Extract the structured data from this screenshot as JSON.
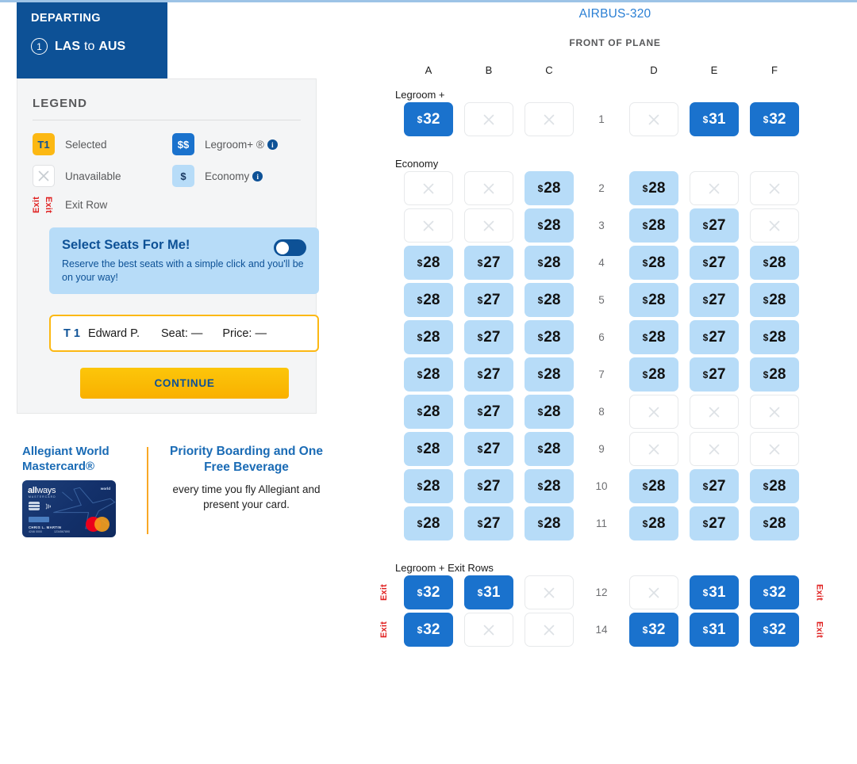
{
  "header": {
    "departing_label": "DEPARTING",
    "segment_number": "1",
    "origin": "LAS",
    "connector": "to",
    "destination": "AUS"
  },
  "legend": {
    "title": "LEGEND",
    "selected_chip": "T1",
    "selected_label": "Selected",
    "unavailable_label": "Unavailable",
    "exit_row_label": "Exit Row",
    "exit_word": "Exit",
    "legroom_chip": "$$",
    "legroom_label": "Legroom+ ®",
    "economy_chip": "$",
    "economy_label": "Economy",
    "info_glyph": "i"
  },
  "auto_select": {
    "title": "Select Seats For Me!",
    "subtitle": "Reserve the best seats with a simple click and you'll be on your way!",
    "toggle_state": "off"
  },
  "passenger": {
    "tag": "T 1",
    "name": "Edward P.",
    "seat": "Seat: —",
    "price": "Price: —"
  },
  "continue_label": "CONTINUE",
  "promo": {
    "card_title": "Allegiant World Mastercard®",
    "headline": "Priority Boarding and One Free Beverage",
    "body": "every time you fly Allegiant and present your card.",
    "card_brand_bold": "all",
    "card_brand_light": "ways",
    "card_brand_sub": "MASTERCARD",
    "card_world": "world",
    "card_holder": "CHRIS L. MARTIN",
    "card_num": "4246 0000",
    "card_num2": "1234567890"
  },
  "seatmap": {
    "plane": "AIRBUS-320",
    "front_label": "FRONT OF PLANE",
    "columns": [
      "A",
      "B",
      "C",
      "D",
      "E",
      "F"
    ],
    "section_legroom": "Legroom +",
    "section_economy": "Economy",
    "section_exit": "Legroom + Exit Rows",
    "currency": "$",
    "rows": [
      {
        "num": "1",
        "exit": false,
        "seats": [
          {
            "type": "legroom",
            "price": "32"
          },
          {
            "type": "unavailable"
          },
          {
            "type": "unavailable"
          },
          {
            "type": "unavailable"
          },
          {
            "type": "legroom",
            "price": "31"
          },
          {
            "type": "legroom",
            "price": "32"
          }
        ]
      },
      {
        "num": "2",
        "exit": false,
        "seats": [
          {
            "type": "unavailable"
          },
          {
            "type": "unavailable"
          },
          {
            "type": "economy",
            "price": "28"
          },
          {
            "type": "economy",
            "price": "28"
          },
          {
            "type": "unavailable"
          },
          {
            "type": "unavailable"
          }
        ]
      },
      {
        "num": "3",
        "exit": false,
        "seats": [
          {
            "type": "unavailable"
          },
          {
            "type": "unavailable"
          },
          {
            "type": "economy",
            "price": "28"
          },
          {
            "type": "economy",
            "price": "28"
          },
          {
            "type": "economy",
            "price": "27"
          },
          {
            "type": "unavailable"
          }
        ]
      },
      {
        "num": "4",
        "exit": false,
        "seats": [
          {
            "type": "economy",
            "price": "28"
          },
          {
            "type": "economy",
            "price": "27"
          },
          {
            "type": "economy",
            "price": "28"
          },
          {
            "type": "economy",
            "price": "28"
          },
          {
            "type": "economy",
            "price": "27"
          },
          {
            "type": "economy",
            "price": "28"
          }
        ]
      },
      {
        "num": "5",
        "exit": false,
        "seats": [
          {
            "type": "economy",
            "price": "28"
          },
          {
            "type": "economy",
            "price": "27"
          },
          {
            "type": "economy",
            "price": "28"
          },
          {
            "type": "economy",
            "price": "28"
          },
          {
            "type": "economy",
            "price": "27"
          },
          {
            "type": "economy",
            "price": "28"
          }
        ]
      },
      {
        "num": "6",
        "exit": false,
        "seats": [
          {
            "type": "economy",
            "price": "28"
          },
          {
            "type": "economy",
            "price": "27"
          },
          {
            "type": "economy",
            "price": "28"
          },
          {
            "type": "economy",
            "price": "28"
          },
          {
            "type": "economy",
            "price": "27"
          },
          {
            "type": "economy",
            "price": "28"
          }
        ]
      },
      {
        "num": "7",
        "exit": false,
        "seats": [
          {
            "type": "economy",
            "price": "28"
          },
          {
            "type": "economy",
            "price": "27"
          },
          {
            "type": "economy",
            "price": "28"
          },
          {
            "type": "economy",
            "price": "28"
          },
          {
            "type": "economy",
            "price": "27"
          },
          {
            "type": "economy",
            "price": "28"
          }
        ]
      },
      {
        "num": "8",
        "exit": false,
        "seats": [
          {
            "type": "economy",
            "price": "28"
          },
          {
            "type": "economy",
            "price": "27"
          },
          {
            "type": "economy",
            "price": "28"
          },
          {
            "type": "unavailable"
          },
          {
            "type": "unavailable"
          },
          {
            "type": "unavailable"
          }
        ]
      },
      {
        "num": "9",
        "exit": false,
        "seats": [
          {
            "type": "economy",
            "price": "28"
          },
          {
            "type": "economy",
            "price": "27"
          },
          {
            "type": "economy",
            "price": "28"
          },
          {
            "type": "unavailable"
          },
          {
            "type": "unavailable"
          },
          {
            "type": "unavailable"
          }
        ]
      },
      {
        "num": "10",
        "exit": false,
        "seats": [
          {
            "type": "economy",
            "price": "28"
          },
          {
            "type": "economy",
            "price": "27"
          },
          {
            "type": "economy",
            "price": "28"
          },
          {
            "type": "economy",
            "price": "28"
          },
          {
            "type": "economy",
            "price": "27"
          },
          {
            "type": "economy",
            "price": "28"
          }
        ]
      },
      {
        "num": "11",
        "exit": false,
        "seats": [
          {
            "type": "economy",
            "price": "28"
          },
          {
            "type": "economy",
            "price": "27"
          },
          {
            "type": "economy",
            "price": "28"
          },
          {
            "type": "economy",
            "price": "28"
          },
          {
            "type": "economy",
            "price": "27"
          },
          {
            "type": "economy",
            "price": "28"
          }
        ]
      },
      {
        "num": "12",
        "exit": true,
        "seats": [
          {
            "type": "legroom",
            "price": "32"
          },
          {
            "type": "legroom",
            "price": "31"
          },
          {
            "type": "unavailable"
          },
          {
            "type": "unavailable"
          },
          {
            "type": "legroom",
            "price": "31"
          },
          {
            "type": "legroom",
            "price": "32"
          }
        ]
      },
      {
        "num": "14",
        "exit": true,
        "seats": [
          {
            "type": "legroom",
            "price": "32"
          },
          {
            "type": "unavailable"
          },
          {
            "type": "unavailable"
          },
          {
            "type": "legroom",
            "price": "32"
          },
          {
            "type": "legroom",
            "price": "31"
          },
          {
            "type": "legroom",
            "price": "32"
          }
        ]
      }
    ]
  },
  "colors": {
    "brand_blue": "#0d5196",
    "legroom_blue": "#1a72cd",
    "economy_blue": "#b7dcf8",
    "accent_yellow": "#fcb813",
    "exit_red": "#e02020",
    "plane_link": "#2a7fd4"
  }
}
